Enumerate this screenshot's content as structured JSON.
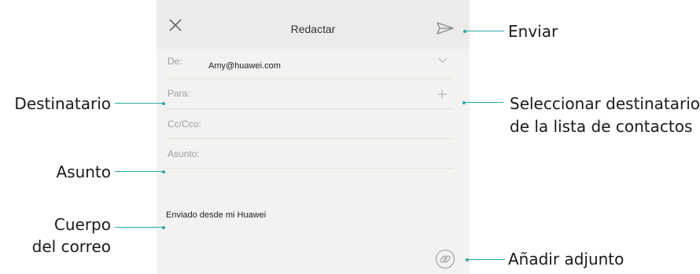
{
  "compose": {
    "title": "Redactar",
    "from_label": "De:",
    "from_value": "Amy@huawei.com",
    "to_label": "Para:",
    "cc_label": "Cc/Cco:",
    "subject_label": "Asunto:",
    "body_text": "Enviado desde mi Huawei"
  },
  "icons": {
    "close": "close-icon",
    "send": "send-icon",
    "chevron": "chevron-down-icon",
    "add": "plus-icon",
    "attach": "paperclip-icon"
  },
  "callouts": {
    "send": "Enviar",
    "recipient": "Destinatario",
    "select_contact_line1": "Seleccionar destinatario",
    "select_contact_line2": "de la lista de contactos",
    "subject": "Asunto",
    "body_line1": "Cuerpo",
    "body_line2": "del correo",
    "attach": "Añadir adjunto"
  },
  "colors": {
    "callout_line": "#2aa8a8",
    "screen_bg": "#f3f2f0",
    "topbar_bg": "#ecebe9"
  }
}
